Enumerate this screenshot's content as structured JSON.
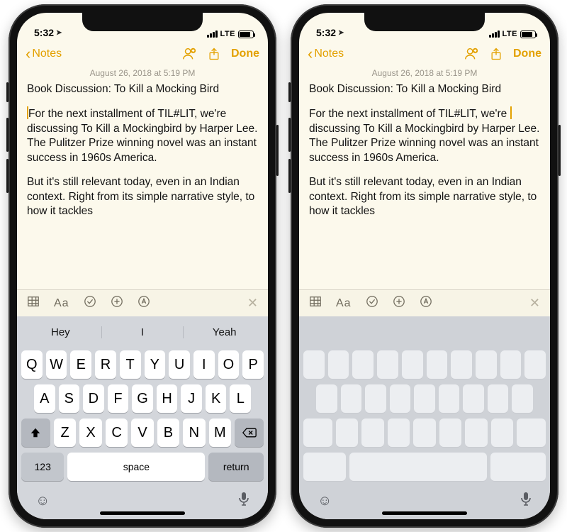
{
  "status": {
    "time": "5:32",
    "carrier_label": "LTE"
  },
  "nav": {
    "back_label": "Notes",
    "done_label": "Done"
  },
  "note": {
    "timestamp": "August 26, 2018 at 5:19 PM",
    "title": "Book Discussion: To Kill a Mocking Bird",
    "para1": "For the next installment of TIL#LIT, we're discussing To Kill a Mockingbird by Harper Lee. The Pulitzer Prize winning novel was an instant success in 1960s America.",
    "para2": "But it's still relevant today, even in an Indian context. Right from its simple narrative style, to how it tackles"
  },
  "note_toolbar": {
    "aa": "Aa"
  },
  "keyboard": {
    "suggestions": [
      "Hey",
      "I",
      "Yeah"
    ],
    "row1": [
      "Q",
      "W",
      "E",
      "R",
      "T",
      "Y",
      "U",
      "I",
      "O",
      "P"
    ],
    "row2": [
      "A",
      "S",
      "D",
      "F",
      "G",
      "H",
      "J",
      "K",
      "L"
    ],
    "row3": [
      "Z",
      "X",
      "C",
      "V",
      "B",
      "N",
      "M"
    ],
    "k123": "123",
    "space": "space",
    "return": "return"
  }
}
